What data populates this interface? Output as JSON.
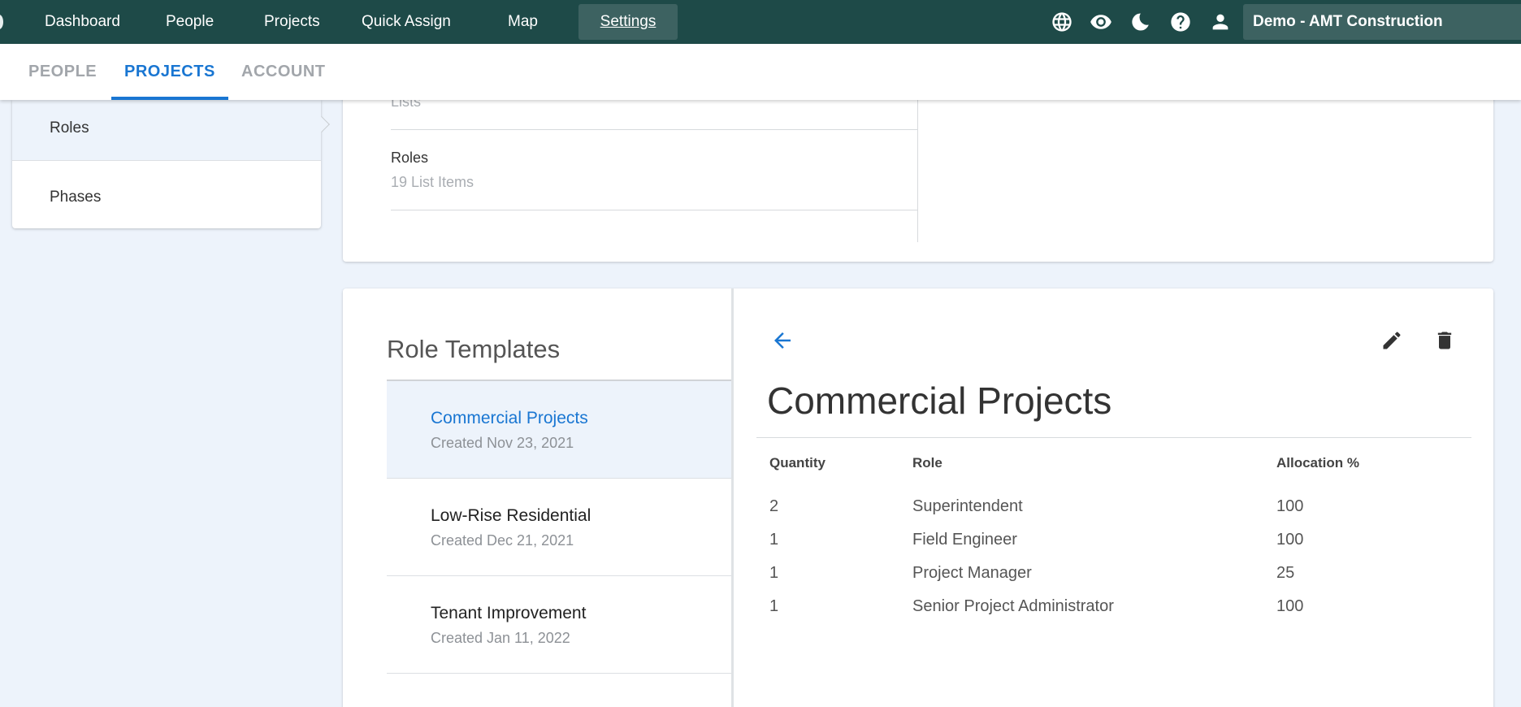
{
  "topnav": {
    "items": [
      "Dashboard",
      "People",
      "Projects",
      "Quick Assign",
      "Map"
    ],
    "active": "Settings",
    "org": "Demo - AMT Construction",
    "icons": [
      "globe-icon",
      "eye-icon",
      "moon-icon",
      "help-icon",
      "person-icon"
    ],
    "bar_color": "#1e4a48"
  },
  "subtabs": [
    "PEOPLE",
    "PROJECTS",
    "ACCOUNT"
  ],
  "subtab_active": "PROJECTS",
  "accent_color": "#1976d2",
  "sidebar": {
    "items": [
      {
        "label": "Roles",
        "selected": true
      },
      {
        "label": "Phases",
        "selected": false
      }
    ]
  },
  "lists": {
    "partial_label": "Lists",
    "items": [
      {
        "title": "Roles",
        "subtitle": "19 List Items"
      }
    ]
  },
  "templates": {
    "heading": "Role Templates",
    "items": [
      {
        "name": "Commercial Projects",
        "created": "Created Nov 23, 2021",
        "selected": true
      },
      {
        "name": "Low-Rise Residential",
        "created": "Created Dec 21, 2021",
        "selected": false
      },
      {
        "name": "Tenant Improvement",
        "created": "Created Jan 11, 2022",
        "selected": false
      }
    ]
  },
  "detail": {
    "title": "Commercial Projects",
    "columns": [
      "Quantity",
      "Role",
      "Allocation %"
    ],
    "rows": [
      {
        "quantity": "2",
        "role": "Superintendent",
        "allocation": "100"
      },
      {
        "quantity": "1",
        "role": "Field Engineer",
        "allocation": "100"
      },
      {
        "quantity": "1",
        "role": "Project Manager",
        "allocation": "25"
      },
      {
        "quantity": "1",
        "role": "Senior Project Administrator",
        "allocation": "100"
      }
    ]
  }
}
